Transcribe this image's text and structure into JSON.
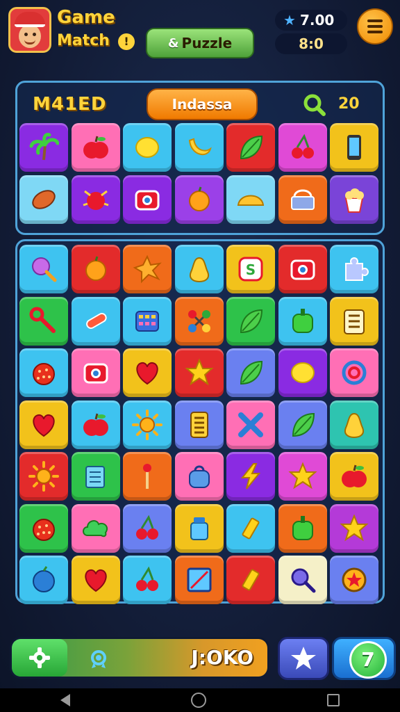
{
  "header": {
    "title_line1": "Game",
    "title_line2": "Match",
    "info_label": "!",
    "puzzle_button": {
      "symbol": "&",
      "label": "Puzzle"
    },
    "score_value": "7.00",
    "timer_value": "8:0",
    "accent_color": "#ffd43b"
  },
  "panel_top": {
    "level_label": "M41ED",
    "mode_button": "Indassa",
    "search_count": "20",
    "tiles": [
      {
        "bg": "#8a2be2",
        "icon": "palm-icon"
      },
      {
        "bg": "#ff6fb5",
        "icon": "apple-icon"
      },
      {
        "bg": "#3ec3f0",
        "icon": "lemon-icon"
      },
      {
        "bg": "#3ec3f0",
        "icon": "banana-icon"
      },
      {
        "bg": "#e32b2b",
        "icon": "leaf-icon"
      },
      {
        "bg": "#e04ad6",
        "icon": "cherry-icon"
      },
      {
        "bg": "#f2c21b",
        "icon": "phone-icon"
      },
      {
        "bg": "#7fd8f5",
        "icon": "football-icon"
      },
      {
        "bg": "#8a2be2",
        "icon": "bug-icon"
      },
      {
        "bg": "#8a2be2",
        "icon": "camera-icon"
      },
      {
        "bg": "#9b40e8",
        "icon": "orange-icon"
      },
      {
        "bg": "#7fd8f5",
        "icon": "taco-icon"
      },
      {
        "bg": "#f06b1a",
        "icon": "basket-icon"
      },
      {
        "bg": "#7a44d8",
        "icon": "popcorn-icon"
      }
    ]
  },
  "board": {
    "tiles": [
      {
        "bg": "#3ec3f0",
        "icon": "lollipop-icon"
      },
      {
        "bg": "#e32b2b",
        "icon": "orange-icon"
      },
      {
        "bg": "#f06b1a",
        "icon": "star-burst-icon"
      },
      {
        "bg": "#3ec3f0",
        "icon": "pear-icon"
      },
      {
        "bg": "#f2c21b",
        "icon": "s-badge-icon"
      },
      {
        "bg": "#e32b2b",
        "icon": "camera-icon"
      },
      {
        "bg": "#3ec3f0",
        "icon": "puzzle-piece-icon"
      },
      {
        "bg": "#2ec24a",
        "icon": "wrench-icon"
      },
      {
        "bg": "#3ec3f0",
        "icon": "candy-icon"
      },
      {
        "bg": "#3ec3f0",
        "icon": "calculator-icon"
      },
      {
        "bg": "#f06b1a",
        "icon": "molecule-icon"
      },
      {
        "bg": "#2ec24a",
        "icon": "leaf-icon"
      },
      {
        "bg": "#3ec3f0",
        "icon": "pepper-icon"
      },
      {
        "bg": "#f2c21b",
        "icon": "notes-icon"
      },
      {
        "bg": "#3ec3f0",
        "icon": "tomato-icon"
      },
      {
        "bg": "#ff6fb5",
        "icon": "camera-icon"
      },
      {
        "bg": "#f2c21b",
        "icon": "heart-icon"
      },
      {
        "bg": "#e32b2b",
        "icon": "star-icon"
      },
      {
        "bg": "#6a80f0",
        "icon": "leaf-icon"
      },
      {
        "bg": "#8a2be2",
        "icon": "lemon-icon"
      },
      {
        "bg": "#ff6fb5",
        "icon": "ring-icon"
      },
      {
        "bg": "#f2c21b",
        "icon": "heart-icon"
      },
      {
        "bg": "#3ec3f0",
        "icon": "apple-icon"
      },
      {
        "bg": "#3ec3f0",
        "icon": "sun-icon"
      },
      {
        "bg": "#6a80f0",
        "icon": "list-icon"
      },
      {
        "bg": "#ff6fb5",
        "icon": "ribbon-icon"
      },
      {
        "bg": "#6a80f0",
        "icon": "leaf-icon"
      },
      {
        "bg": "#2ec4b0",
        "icon": "pear-icon"
      },
      {
        "bg": "#e32b2b",
        "icon": "sun-icon"
      },
      {
        "bg": "#2ec24a",
        "icon": "box-icon"
      },
      {
        "bg": "#f06b1a",
        "icon": "match-icon"
      },
      {
        "bg": "#ff6fb5",
        "icon": "bag-icon"
      },
      {
        "bg": "#8a2be2",
        "icon": "lightning-icon"
      },
      {
        "bg": "#e04ad6",
        "icon": "star-icon"
      },
      {
        "bg": "#f2c21b",
        "icon": "apple-icon"
      },
      {
        "bg": "#2ec24a",
        "icon": "tomato-icon"
      },
      {
        "bg": "#ff6fb5",
        "icon": "cloud-icon"
      },
      {
        "bg": "#6a80f0",
        "icon": "cherry-icon"
      },
      {
        "bg": "#f2c21b",
        "icon": "jar-icon"
      },
      {
        "bg": "#3ec3f0",
        "icon": "crayon-icon"
      },
      {
        "bg": "#f06b1a",
        "icon": "pepper-icon"
      },
      {
        "bg": "#b43ad8",
        "icon": "star-icon"
      },
      {
        "bg": "#3ec3f0",
        "icon": "plum-icon"
      },
      {
        "bg": "#f2c21b",
        "icon": "heart-icon"
      },
      {
        "bg": "#3ec3f0",
        "icon": "cherry-icon"
      },
      {
        "bg": "#f06b1a",
        "icon": "frame-icon"
      },
      {
        "bg": "#e32b2b",
        "icon": "crayon-icon"
      },
      {
        "bg": "#f5f0c8",
        "icon": "magnifier-icon"
      },
      {
        "bg": "#6a80f0",
        "icon": "medal-icon"
      }
    ]
  },
  "bottom_bar": {
    "progress_text": "J:OKO",
    "progress_fraction": 1.0,
    "hint_label": "7"
  }
}
